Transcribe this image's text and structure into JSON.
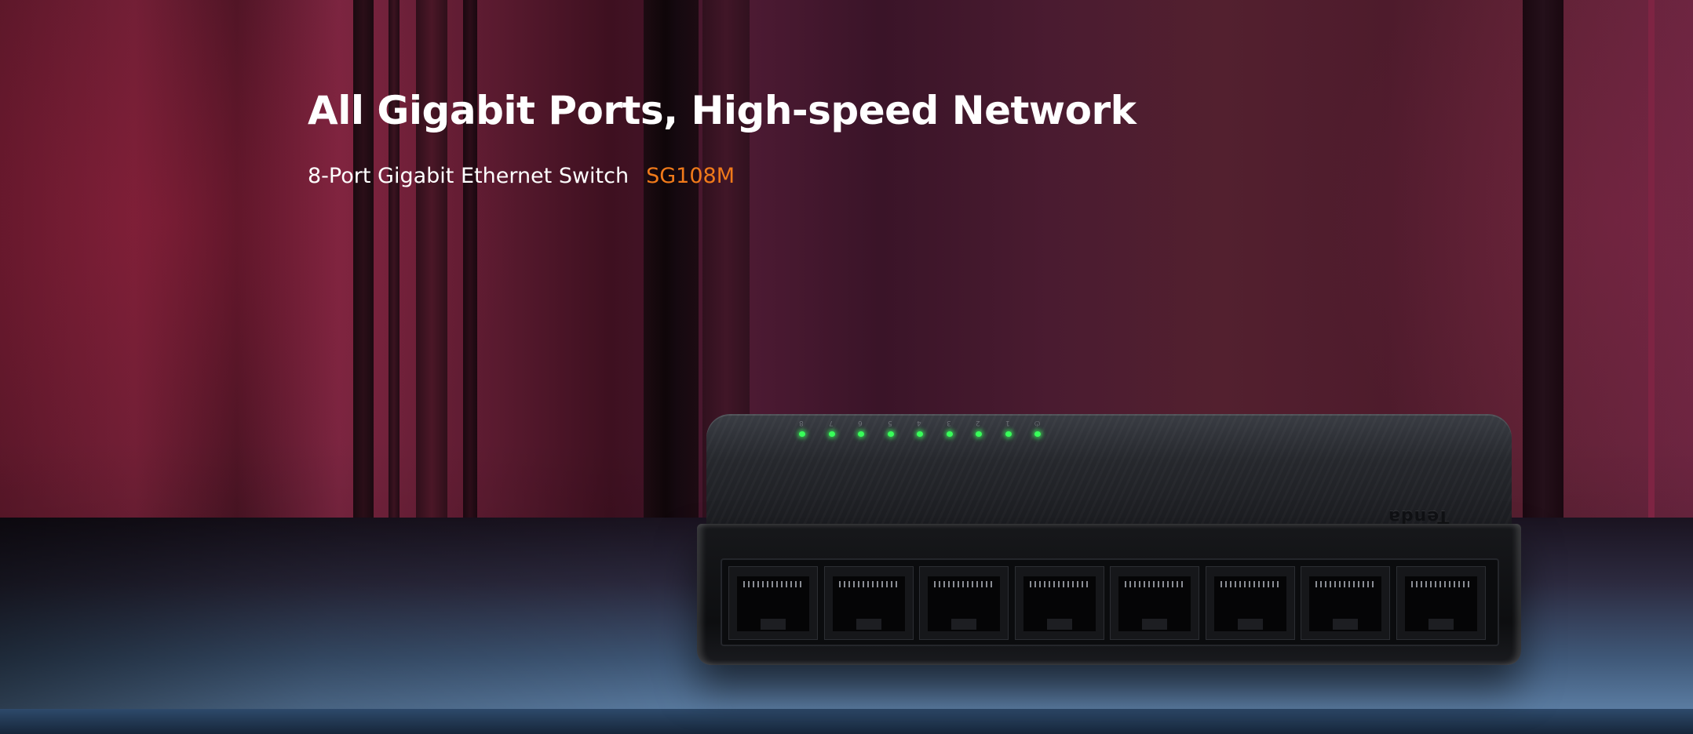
{
  "hero": {
    "headline": "All Gigabit Ports, High-speed Network",
    "subtitle": "8-Port Gigabit Ethernet Switch",
    "model": "SG108M",
    "model_color": "#f07a1a"
  },
  "device": {
    "brand": "Tenda",
    "led_labels": [
      "8",
      "7",
      "6",
      "5",
      "4",
      "3",
      "2",
      "1",
      "⏻"
    ],
    "port_count": 8,
    "led_color": "#38ff5a"
  }
}
